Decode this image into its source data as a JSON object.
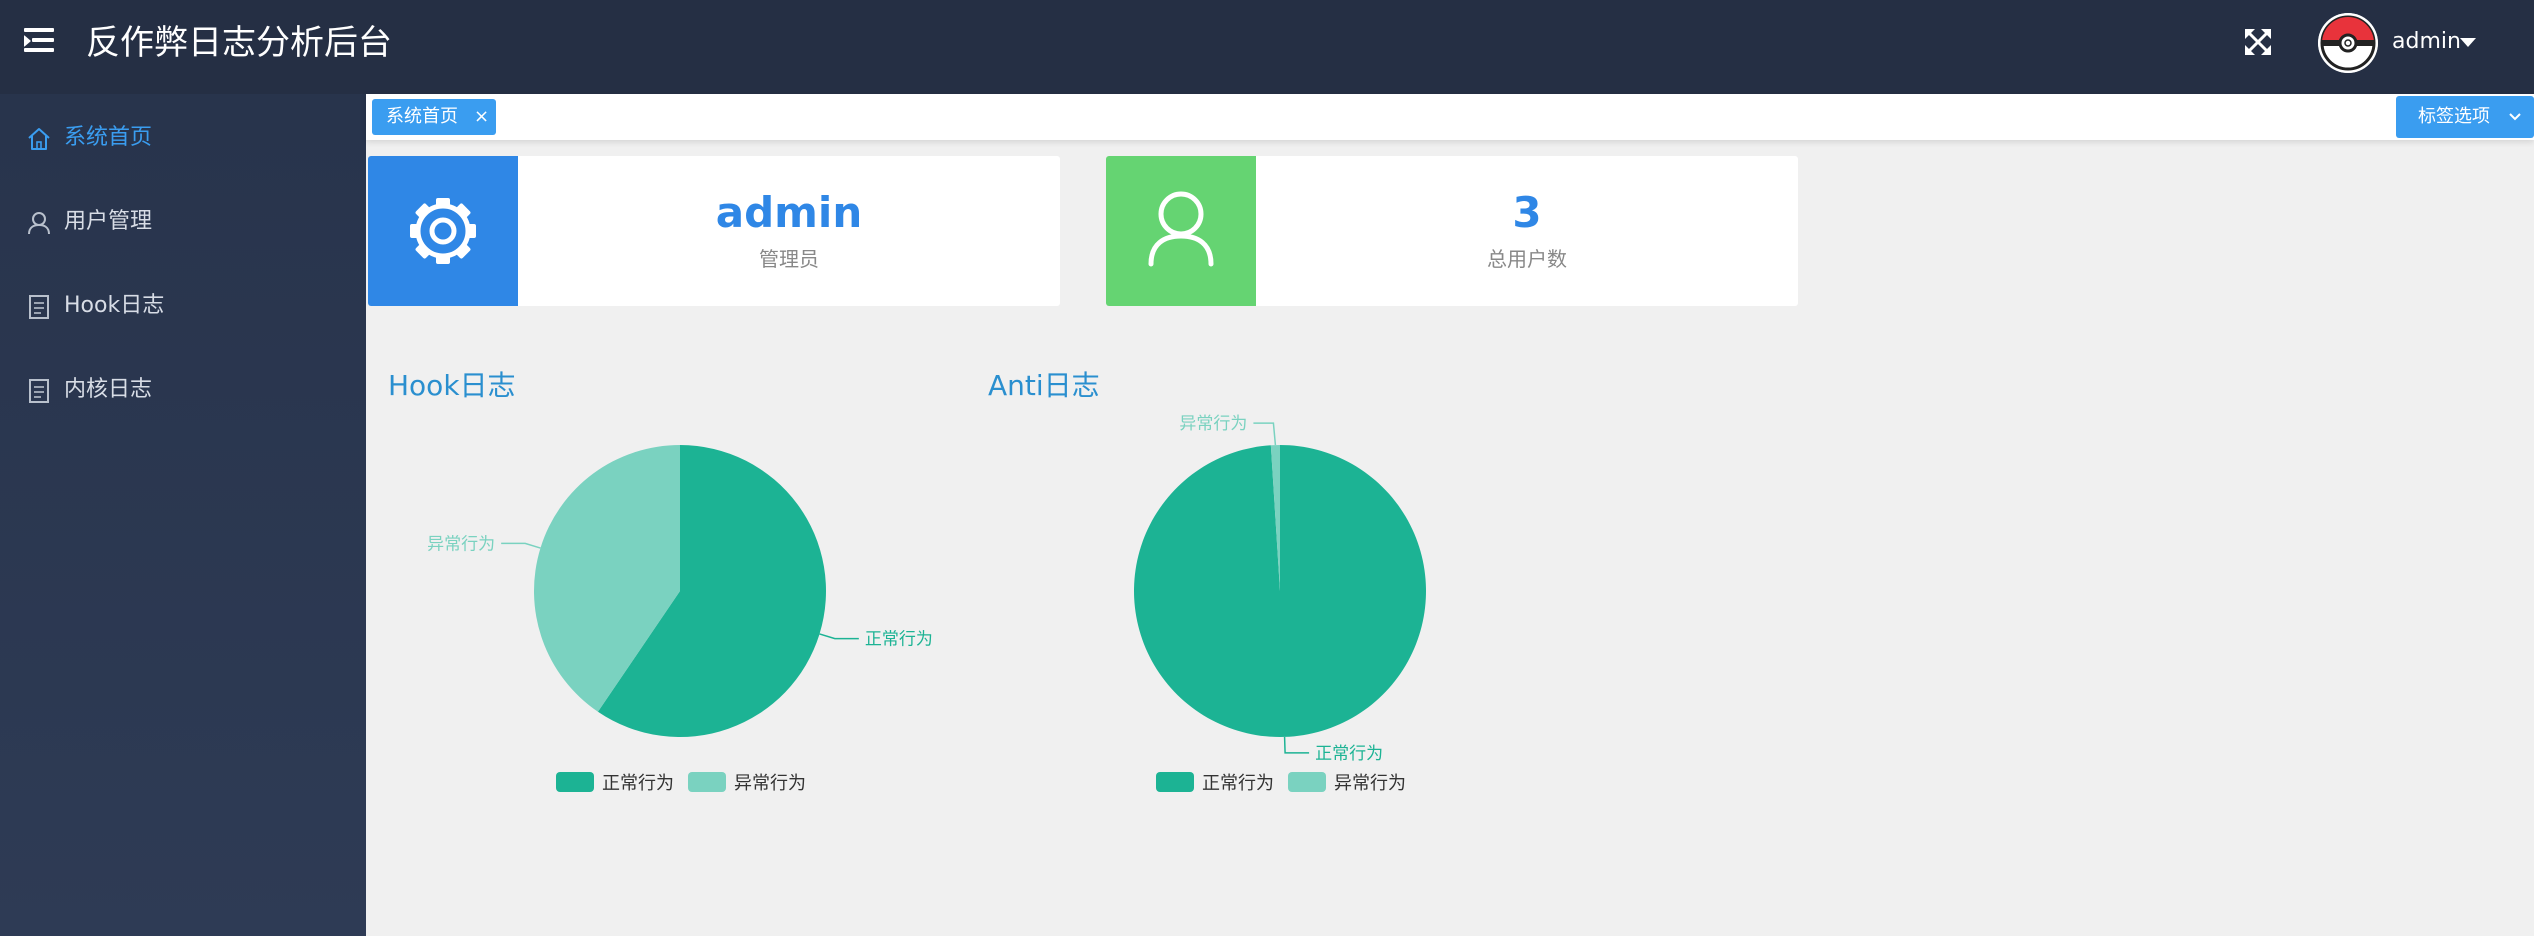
{
  "header": {
    "title": "反作弊日志分析后台",
    "user_name": "admin",
    "menu_icon": "menu-icon",
    "fullscreen_icon": "fullscreen-icon",
    "avatar_icon": "pokeball-avatar"
  },
  "sidebar": {
    "items": [
      {
        "label": "系统首页",
        "icon": "home-icon",
        "active": true
      },
      {
        "label": "用户管理",
        "icon": "user-icon",
        "active": false
      },
      {
        "label": "Hook日志",
        "icon": "document-icon",
        "active": false
      },
      {
        "label": "内核日志",
        "icon": "document-icon",
        "active": false
      }
    ]
  },
  "tabs": {
    "items": [
      {
        "label": "系统首页",
        "close": "×"
      }
    ],
    "options_label": "标签选项"
  },
  "cards": [
    {
      "value": "admin",
      "label": "管理员",
      "icon": "gear-icon",
      "color": "#2f87e6"
    },
    {
      "value": "3",
      "label": "总用户数",
      "icon": "user-icon",
      "color": "#65d472"
    }
  ],
  "colors": {
    "normal": "#1cb394",
    "abnormal": "#7ad2c0",
    "accent": "#3a9df0",
    "header_bg": "#252f44"
  },
  "chart_data": [
    {
      "type": "pie",
      "title": "Hook日志",
      "slices": [
        {
          "name": "正常行为",
          "value": 59.5
        },
        {
          "name": "异常行为",
          "value": 40.5
        }
      ],
      "legend": [
        "正常行为",
        "异常行为"
      ],
      "legend_placement": "bottom"
    },
    {
      "type": "pie",
      "title": "Anti日志",
      "slices": [
        {
          "name": "正常行为",
          "value": 99
        },
        {
          "name": "异常行为",
          "value": 1
        }
      ],
      "legend": [
        "正常行为",
        "异常行为"
      ],
      "legend_placement": "bottom"
    }
  ]
}
